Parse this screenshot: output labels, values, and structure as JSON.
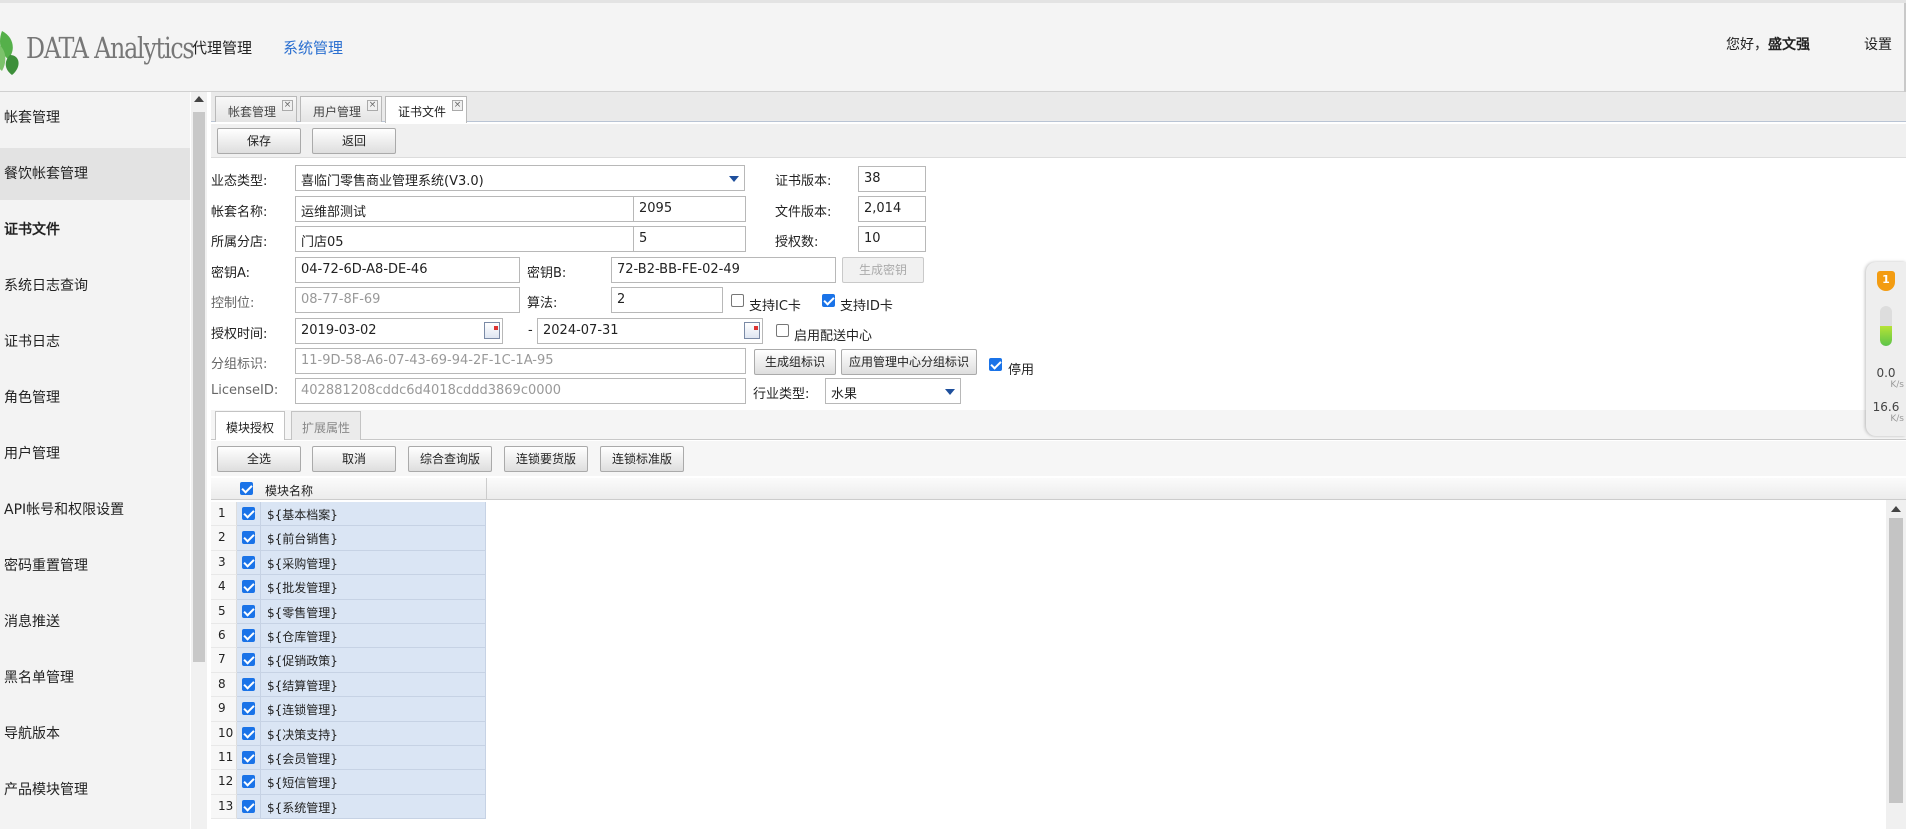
{
  "header": {
    "brand": "DATA Analytics",
    "nav": [
      "代理管理",
      "系统管理"
    ],
    "greeting": "您好，",
    "user": "盛文强",
    "settings": "设置"
  },
  "sidebar": {
    "items": [
      "帐套管理",
      "餐饮帐套管理",
      "证书文件",
      "系统日志查询",
      "证书日志",
      "角色管理",
      "用户管理",
      "API帐号和权限设置",
      "密码重置管理",
      "消息推送",
      "黑名单管理",
      "导航版本",
      "产品模块管理"
    ]
  },
  "tabs": [
    "帐套管理",
    "用户管理",
    "证书文件"
  ],
  "toolbar": {
    "save": "保存",
    "back": "返回"
  },
  "form": {
    "business_type_label": "业态类型:",
    "business_type_value": "喜临门零售商业管理系统(V3.0)",
    "cert_version_label": "证书版本:",
    "cert_version_value": "38",
    "account_name_label": "帐套名称:",
    "account_name_value": "运维部测试",
    "account_code_value": "2095",
    "file_version_label": "文件版本:",
    "file_version_value": "2,014",
    "branch_label": "所属分店:",
    "branch_value": "门店05",
    "branch_count_value": "5",
    "auth_count_label": "授权数:",
    "auth_count_value": "10",
    "key_a_label": "密钥A:",
    "key_a_value": "04-72-6D-A8-DE-46",
    "key_b_label": "密钥B:",
    "key_b_value": "72-B2-BB-FE-02-49",
    "gen_key_button": "生成密钥",
    "control_label": "控制位:",
    "control_value": "08-77-8F-69",
    "algo_label": "算法:",
    "algo_value": "2",
    "ic_card_label": "支持IC卡",
    "ic_card_checked": false,
    "id_card_label": "支持ID卡",
    "id_card_checked": true,
    "auth_time_label": "授权时间:",
    "auth_start": "2019-03-02",
    "dash": "-",
    "auth_end": "2024-07-31",
    "distribution_label": "启用配送中心",
    "distribution_checked": false,
    "group_label": "分组标识:",
    "group_value": "11-9D-58-A6-07-43-69-94-2F-1C-1A-95",
    "gen_group_button": "生成组标识",
    "app_group_button": "应用管理中心分组标识",
    "disable_label": "停用",
    "disable_checked": true,
    "license_label": "LicenseID:",
    "license_value": "402881208cddc6d4018cddd3869c0000",
    "industry_label": "行业类型:",
    "industry_value": "水果"
  },
  "subtabs": [
    "模块授权",
    "扩展属性"
  ],
  "toolbar2": [
    "全选",
    "取消",
    "综合查询版",
    "连锁要货版",
    "连锁标准版"
  ],
  "grid": {
    "column_header": "模块名称",
    "rows": [
      {
        "no": "1",
        "name": "${基本档案}",
        "checked": true
      },
      {
        "no": "2",
        "name": "${前台销售}",
        "checked": true
      },
      {
        "no": "3",
        "name": "${采购管理}",
        "checked": true
      },
      {
        "no": "4",
        "name": "${批发管理}",
        "checked": true
      },
      {
        "no": "5",
        "name": "${零售管理}",
        "checked": true
      },
      {
        "no": "6",
        "name": "${仓库管理}",
        "checked": true
      },
      {
        "no": "7",
        "name": "${促销政策}",
        "checked": true
      },
      {
        "no": "8",
        "name": "${结算管理}",
        "checked": true
      },
      {
        "no": "9",
        "name": "${连锁管理}",
        "checked": true
      },
      {
        "no": "10",
        "name": "${决策支持}",
        "checked": true
      },
      {
        "no": "11",
        "name": "${会员管理}",
        "checked": true
      },
      {
        "no": "12",
        "name": "${短信管理}",
        "checked": true
      },
      {
        "no": "13",
        "name": "${系统管理}",
        "checked": true
      }
    ]
  },
  "widget": {
    "badge": "1",
    "level": 0.5,
    "upload": "0.0",
    "upload_unit": "K/s",
    "download": "16.6",
    "download_unit": "K/s"
  },
  "colors": {
    "accent": "#2a6fd0",
    "row_selected": "#dae5f4",
    "logo_green": "#4caf50"
  }
}
